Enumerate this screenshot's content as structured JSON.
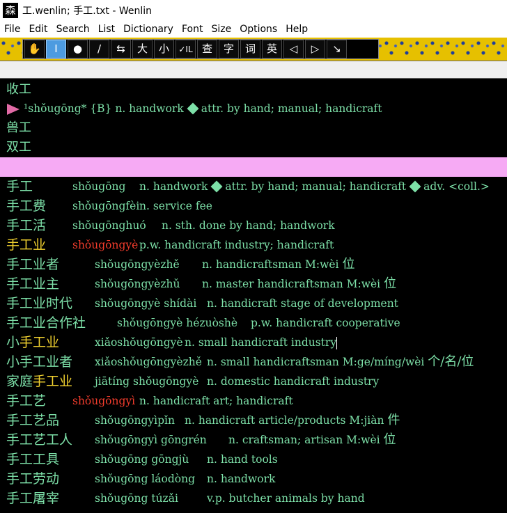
{
  "window": {
    "title": "工.wenlin; 手工.txt - Wenlin",
    "icon_char": "森"
  },
  "menu": [
    "File",
    "Edit",
    "Search",
    "List",
    "Dictionary",
    "Font",
    "Size",
    "Options",
    "Help"
  ],
  "toolbar": {
    "buttons": [
      "✋",
      "I",
      "●",
      "/",
      "⇆",
      "大",
      "小",
      "✓IL",
      "查",
      "字",
      "词",
      "英",
      "◁",
      "▷",
      "↘"
    ],
    "active_index": 1
  },
  "upper_panel": {
    "line1": "收工",
    "def_pinyin": "¹shǒugōng* {B} n. handwork",
    "def_sense2": "attr. by hand; manual; handicraft",
    "line3": "兽工",
    "line4": "双工"
  },
  "rows": [
    {
      "hz": "手工",
      "py": "shǒugōng",
      "df": "n. handwork",
      "df2": "attr. by hand; manual; handicraft",
      "df3": "adv. <coll.>"
    },
    {
      "hz": "手工费",
      "py": "shǒugōngfèi",
      "df": "n. service fee"
    },
    {
      "hz": "手工活",
      "py": "shǒugōnghuó",
      "df": "n. sth. done by hand; handwork"
    },
    {
      "hz": "手工业",
      "py": "shǒugōngyè",
      "df": "p.w. handicraft industry; handicraft"
    },
    {
      "hz": "手工业者",
      "py": "shǒugōngyèzhě",
      "df": "n. handicraftsman M:wèi",
      "cjk": "位"
    },
    {
      "hz": "手工业主",
      "py": "shǒugōngyèzhǔ",
      "df": "n. master handicraftsman M:wèi",
      "cjk": "位"
    },
    {
      "hz": "手工业时代",
      "py": "shǒugōngyè shídài",
      "df": "n. handicraft stage of development"
    },
    {
      "hz": "手工业合作社",
      "py": "shǒugōngyè hézuòshè",
      "df": "p.w. handicraft cooperative"
    },
    {
      "hz_pre": "小",
      "hz_hl": "手工业",
      "py": "xiǎoshǒugōngyè",
      "df": "n. small handicraft industry"
    },
    {
      "hz": "小手工业者",
      "py": "xiǎoshǒugōngyèzhě",
      "df": "n. small handicraftsman M:ge/míng/wèi",
      "cjk": "个/名/位"
    },
    {
      "hz_pre": "家庭",
      "hz_hl": "手工业",
      "py": "jiātíng shǒugōngyè",
      "df": "n. domestic handicraft industry"
    },
    {
      "hz": "手工艺",
      "py": "shǒugōngyì",
      "df": "n. handicraft art; handicraft"
    },
    {
      "hz": "手工艺品",
      "py": "shǒugōngyìpǐn",
      "df": "n. handicraft article/products M:jiàn",
      "cjk": "件"
    },
    {
      "hz": "手工艺工人",
      "py": "shǒugōngyì gōngrén",
      "df": "n. craftsman; artisan M:wèi",
      "cjk": "位"
    },
    {
      "hz": "手工工具",
      "py": "shǒugōng gōngjù",
      "df": "n. hand tools"
    },
    {
      "hz": "手工劳动",
      "py": "shǒugōng láodòng",
      "df": "n. handwork"
    },
    {
      "hz": "手工屠宰",
      "py": "shǒugōng túzǎi",
      "df": "v.p. butcher animals by hand"
    }
  ]
}
